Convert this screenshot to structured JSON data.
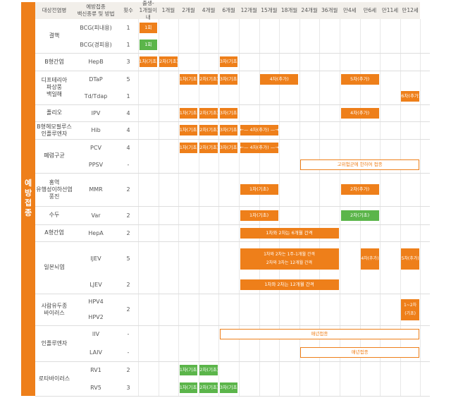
{
  "sidebar_label": "예방접종",
  "colors": {
    "orange": "#ee7f1a",
    "green": "#5bb54a"
  },
  "headers": {
    "disease": "대상전염병",
    "vaccine": "예방접종\n백신종류 및 방법",
    "count": "횟수",
    "ages": [
      "출생-\n1개월이내",
      "1개월",
      "2개월",
      "4개월",
      "6개월",
      "12개월",
      "15개월",
      "18개월",
      "24개월",
      "36개월",
      "만4세",
      "만6세",
      "만11세",
      "만12세"
    ]
  },
  "diseases": [
    "결핵",
    "B형간염",
    "디프테리아\n파상풍\n백일해",
    "폴리오",
    "B형헤모필루스\n인플루엔자",
    "폐렴구균",
    "홍역\n유행성이하선염\n풍진",
    "수두",
    "A형간염",
    "일본뇌염",
    "사람유두종\n바이러스",
    "인플루엔자",
    "로타바이러스"
  ],
  "vaccines": [
    {
      "name": "BCG(피내용)",
      "count": "1"
    },
    {
      "name": "BCG(경피용)",
      "count": "1"
    },
    {
      "name": "HepB",
      "count": "3"
    },
    {
      "name": "DTaP",
      "count": "5"
    },
    {
      "name": "Td/Tdap",
      "count": "1"
    },
    {
      "name": "IPV",
      "count": "4"
    },
    {
      "name": "Hib",
      "count": "4"
    },
    {
      "name": "PCV",
      "count": "4"
    },
    {
      "name": "PPSV",
      "count": "-"
    },
    {
      "name": "MMR",
      "count": "2"
    },
    {
      "name": "Var",
      "count": "2"
    },
    {
      "name": "HepA",
      "count": "2"
    },
    {
      "name": "IJEV",
      "count": "5"
    },
    {
      "name": "LJEV",
      "count": "2"
    },
    {
      "name": "HPV4\n\nHPV2",
      "count": "2"
    },
    {
      "name": "IIV",
      "count": "-"
    },
    {
      "name": "LAIV",
      "count": "-"
    },
    {
      "name": "RV1",
      "count": "2"
    },
    {
      "name": "RV5",
      "count": "3"
    }
  ],
  "bars": [
    {
      "row": 0,
      "start": 0,
      "end": 0,
      "label": "1회",
      "color": "orange"
    },
    {
      "row": 1,
      "start": 0,
      "end": 0,
      "label": "1회",
      "color": "green"
    },
    {
      "row": 2,
      "start": 0,
      "end": 0,
      "label": "1차(기초)",
      "color": "orange"
    },
    {
      "row": 2,
      "start": 1,
      "end": 1,
      "label": "2차(기초)",
      "color": "orange"
    },
    {
      "row": 2,
      "start": 4,
      "end": 4,
      "label": "3차(기초)",
      "color": "orange"
    },
    {
      "row": 3,
      "start": 2,
      "end": 2,
      "label": "1차(기초)",
      "color": "orange"
    },
    {
      "row": 3,
      "start": 3,
      "end": 3,
      "label": "2차(기초)",
      "color": "orange"
    },
    {
      "row": 3,
      "start": 4,
      "end": 4,
      "label": "3차(기초)",
      "color": "orange"
    },
    {
      "row": 3,
      "start": 6,
      "end": 7,
      "label": "4차(추가)",
      "color": "orange"
    },
    {
      "row": 3,
      "start": 10,
      "end": 11,
      "label": "5차(추가)",
      "color": "orange"
    },
    {
      "row": 4,
      "start": 13,
      "end": 13,
      "label": "6차(추가)",
      "color": "orange"
    },
    {
      "row": 5,
      "start": 2,
      "end": 2,
      "label": "1차(기초)",
      "color": "orange"
    },
    {
      "row": 5,
      "start": 3,
      "end": 3,
      "label": "2차(기초)",
      "color": "orange"
    },
    {
      "row": 5,
      "start": 4,
      "end": 4,
      "label": "3차(기초)",
      "color": "orange"
    },
    {
      "row": 5,
      "start": 10,
      "end": 11,
      "label": "4차(추가)",
      "color": "orange"
    },
    {
      "row": 6,
      "start": 2,
      "end": 2,
      "label": "1차(기초)",
      "color": "orange"
    },
    {
      "row": 6,
      "start": 3,
      "end": 3,
      "label": "2차(기초)",
      "color": "orange"
    },
    {
      "row": 6,
      "start": 4,
      "end": 4,
      "label": "3차(기초)",
      "color": "orange"
    },
    {
      "row": 6,
      "start": 5,
      "end": 6,
      "label": "←— 4차(추가) —→",
      "color": "orange"
    },
    {
      "row": 7,
      "start": 2,
      "end": 2,
      "label": "1차(기초)",
      "color": "orange"
    },
    {
      "row": 7,
      "start": 3,
      "end": 3,
      "label": "2차(기초)",
      "color": "orange"
    },
    {
      "row": 7,
      "start": 4,
      "end": 4,
      "label": "3차(기초)",
      "color": "orange"
    },
    {
      "row": 7,
      "start": 5,
      "end": 6,
      "label": "←— 4차(추가) —→",
      "color": "orange"
    },
    {
      "row": 8,
      "start": 8,
      "end": 13,
      "label": "고위험군에 한하여 접종",
      "color": "outline"
    },
    {
      "row": 9,
      "start": 5,
      "end": 6,
      "label": "1차(기초)",
      "color": "orange"
    },
    {
      "row": 9,
      "start": 10,
      "end": 11,
      "label": "2차(추가)",
      "color": "orange"
    },
    {
      "row": 10,
      "start": 5,
      "end": 6,
      "label": "1차(기초)",
      "color": "orange"
    },
    {
      "row": 10,
      "start": 10,
      "end": 11,
      "label": "2차(기초)",
      "color": "green"
    },
    {
      "row": 11,
      "start": 5,
      "end": 9,
      "label": "1차와 2차는 6개월 간격",
      "color": "orange"
    },
    {
      "row": 12,
      "start": 5,
      "end": 9,
      "label": "1차와 2차는 1주-1개월 간격\n2차와 3차는 12개월 간격",
      "color": "orange",
      "two": true
    },
    {
      "row": 12,
      "start": 11,
      "end": 11,
      "label": "4차(추가)",
      "color": "orange",
      "two": true
    },
    {
      "row": 12,
      "start": 13,
      "end": 13,
      "label": "5차(추가)",
      "color": "orange",
      "two": true
    },
    {
      "row": 13,
      "start": 5,
      "end": 9,
      "label": "1차와 2차는 12개월 간격",
      "color": "orange"
    },
    {
      "row": 14,
      "start": 13,
      "end": 13,
      "label": "1~2차\n(기초)",
      "color": "orange",
      "two": true
    },
    {
      "row": 15,
      "start": 4,
      "end": 13,
      "label": "매년접종",
      "color": "outline"
    },
    {
      "row": 16,
      "start": 8,
      "end": 13,
      "label": "매년접종",
      "color": "outline"
    },
    {
      "row": 17,
      "start": 2,
      "end": 2,
      "label": "1차(기초)",
      "color": "green"
    },
    {
      "row": 17,
      "start": 3,
      "end": 3,
      "label": "2차(기초)",
      "color": "green"
    },
    {
      "row": 18,
      "start": 2,
      "end": 2,
      "label": "1차(기초)",
      "color": "green"
    },
    {
      "row": 18,
      "start": 3,
      "end": 3,
      "label": "2차(기초)",
      "color": "green"
    },
    {
      "row": 18,
      "start": 4,
      "end": 4,
      "label": "3차(기초)",
      "color": "green"
    }
  ]
}
